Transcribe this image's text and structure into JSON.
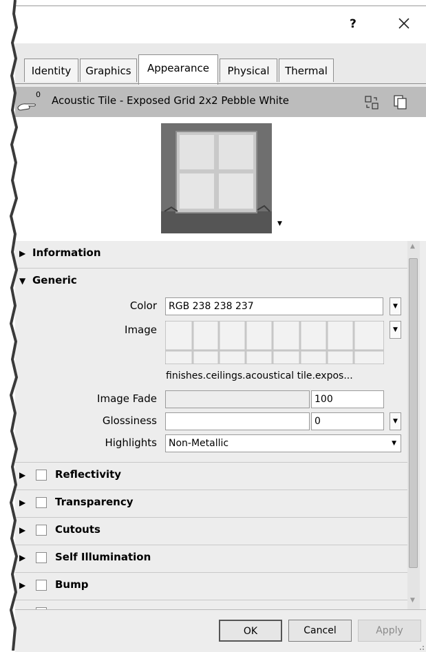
{
  "titlebar": {
    "help_label": "?",
    "close_icon": "close-icon"
  },
  "tabs": [
    {
      "label": "Identity",
      "active": false
    },
    {
      "label": "Graphics",
      "active": false
    },
    {
      "label": "Appearance",
      "active": true
    },
    {
      "label": "Physical",
      "active": false
    },
    {
      "label": "Thermal",
      "active": false
    }
  ],
  "asset": {
    "count": "0",
    "name": "Acoustic Tile - Exposed Grid 2x2 Pebble White",
    "icons": [
      "replace-asset-icon",
      "duplicate-asset-icon"
    ]
  },
  "sections": {
    "information": "Information",
    "generic": "Generic",
    "reflectivity": "Reflectivity",
    "transparency": "Transparency",
    "cutouts": "Cutouts",
    "self_illumination": "Self Illumination",
    "bump": "Bump"
  },
  "generic": {
    "color_label": "Color",
    "color_value": "RGB 238 238 237",
    "image_label": "Image",
    "image_file": "finishes.ceilings.acoustical tile.expos...",
    "image_fade_label": "Image Fade",
    "image_fade_value": "100",
    "glossiness_label": "Glossiness",
    "glossiness_value": "0",
    "highlights_label": "Highlights",
    "highlights_value": "Non-Metallic"
  },
  "footer": {
    "ok": "OK",
    "cancel": "Cancel",
    "apply": "Apply"
  },
  "colors": {
    "header_bg": "#bcbcbc",
    "panel_bg": "#ededed",
    "preview_bg": "#6f6f6f"
  }
}
